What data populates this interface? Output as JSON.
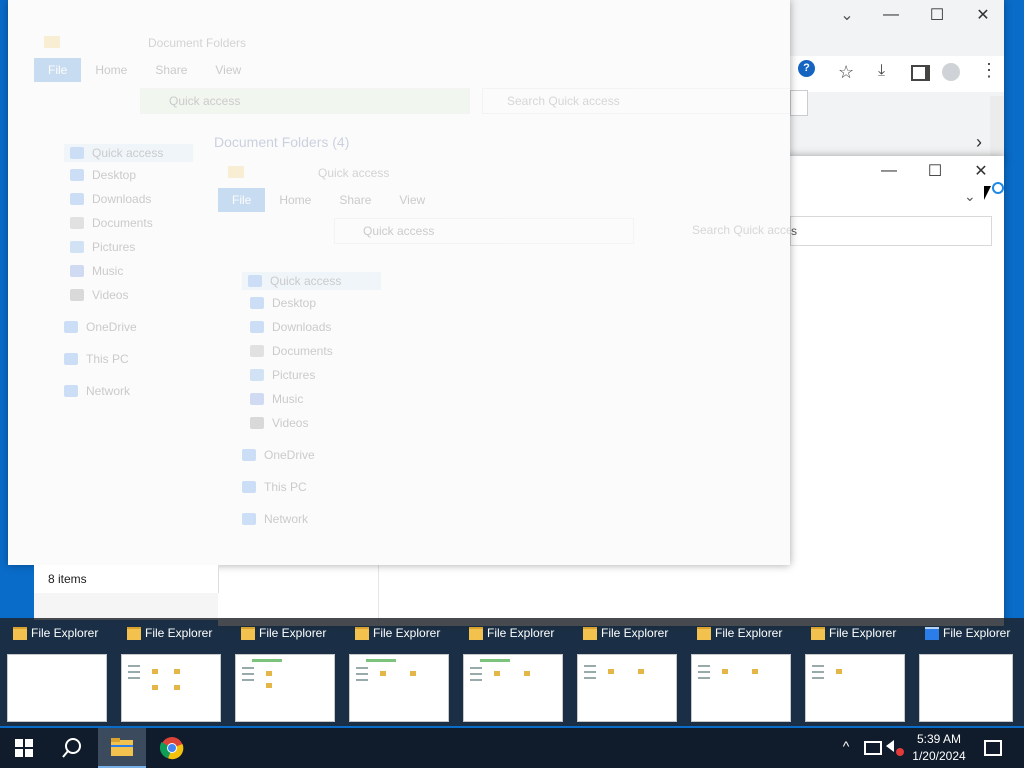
{
  "chrome": {
    "minimize": "—",
    "maximize": "☐",
    "close": "✕",
    "dropdown": "⌄"
  },
  "explorer_back": {
    "title": "Document Folders",
    "tabs": [
      "File",
      "Home",
      "Share",
      "View"
    ],
    "address": "Quick access",
    "search_placeholder": "Search Quick access",
    "section_header": "Document Folders (4)",
    "status": "8 items",
    "nav": [
      {
        "label": "Quick access"
      },
      {
        "label": "Desktop"
      },
      {
        "label": "Downloads"
      },
      {
        "label": "Documents"
      },
      {
        "label": "Pictures"
      },
      {
        "label": "Music"
      },
      {
        "label": "Videos"
      },
      {
        "label": "OneDrive"
      },
      {
        "label": "This PC"
      },
      {
        "label": "Network"
      }
    ]
  },
  "explorer_front": {
    "title": "Quick access",
    "tabs": [
      "File",
      "Home",
      "Share",
      "View"
    ],
    "address": "Quick access",
    "search_placeholder": "Search Quick access",
    "nav": [
      {
        "label": "Quick access"
      },
      {
        "label": "Desktop"
      },
      {
        "label": "Downloads"
      },
      {
        "label": "Documents"
      },
      {
        "label": "Pictures"
      },
      {
        "label": "Music"
      },
      {
        "label": "Videos"
      },
      {
        "label": "OneDrive"
      },
      {
        "label": "This PC"
      },
      {
        "label": "Network"
      }
    ]
  },
  "explorer_right": {
    "search_suffix": "s"
  },
  "task_switcher": {
    "items": [
      {
        "label": "File Explorer",
        "icon": "folder-icon"
      },
      {
        "label": "File Explorer",
        "icon": "folder-icon"
      },
      {
        "label": "File Explorer",
        "icon": "folder-icon"
      },
      {
        "label": "File Explorer",
        "icon": "folder-icon"
      },
      {
        "label": "File Explorer",
        "icon": "folder-icon"
      },
      {
        "label": "File Explorer",
        "icon": "folder-icon"
      },
      {
        "label": "File Explorer",
        "icon": "folder-icon"
      },
      {
        "label": "File Explorer",
        "icon": "folder-icon"
      },
      {
        "label": "File Explorer",
        "icon": "explorer-app-icon"
      }
    ]
  },
  "taskbar": {
    "time": "5:39 AM",
    "date": "1/20/2024"
  },
  "colors": {
    "desktop": "#0a6cc9",
    "taskbar": "#101c2b",
    "accent": "#1a73d0",
    "folder": "#f2c14e"
  }
}
